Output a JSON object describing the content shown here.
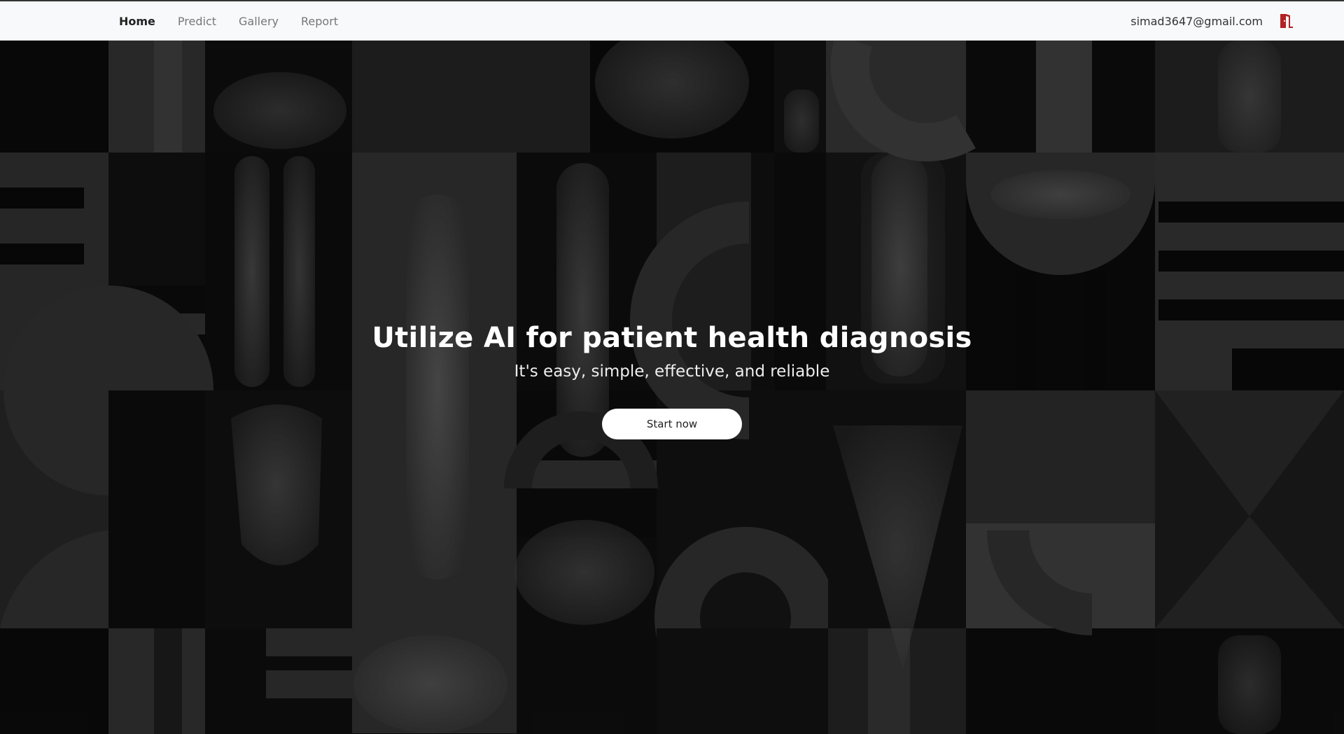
{
  "nav": {
    "links": [
      {
        "label": "Home",
        "active": true
      },
      {
        "label": "Predict",
        "active": false
      },
      {
        "label": "Gallery",
        "active": false
      },
      {
        "label": "Report",
        "active": false
      }
    ],
    "user_email": "simad3647@gmail.com",
    "logout_icon": "door-exit-icon",
    "logout_icon_color": "#c0392b"
  },
  "hero": {
    "title": "Utilize AI for patient health diagnosis",
    "subtitle": "It's easy, simple, effective, and reliable",
    "cta_label": "Start now",
    "background": "x-ray-bones-geometric-collage"
  }
}
